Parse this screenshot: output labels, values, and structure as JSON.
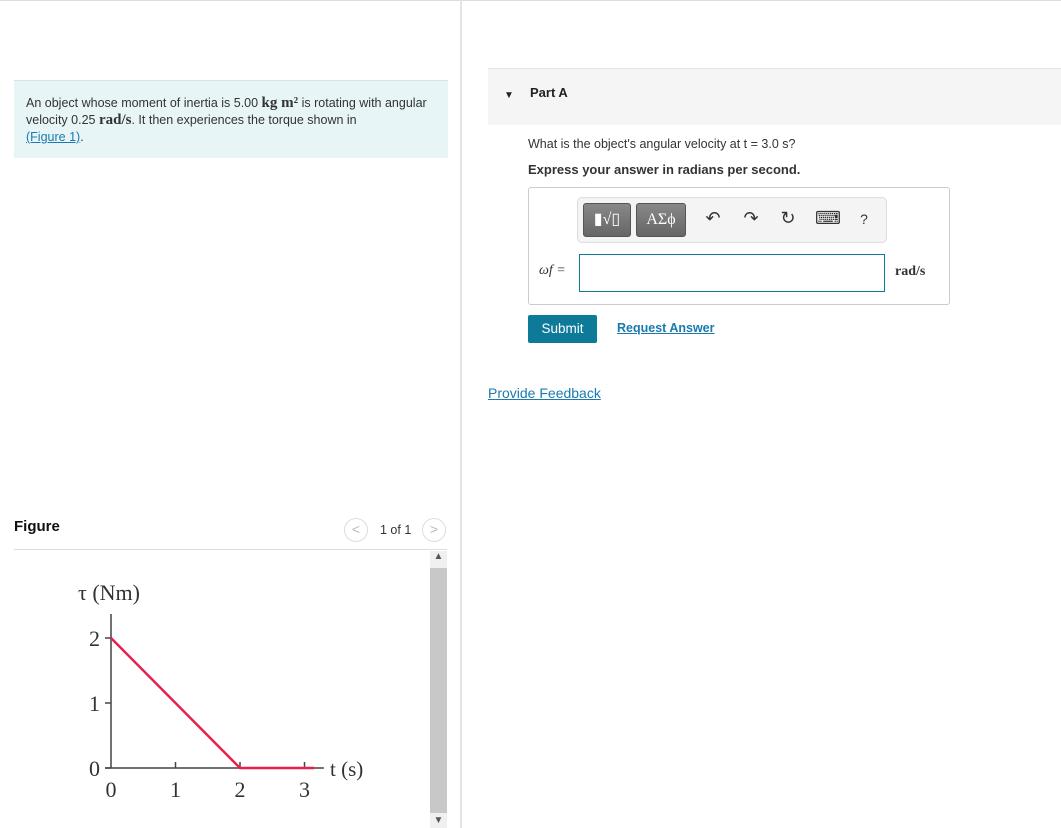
{
  "problem": {
    "t1": "An object whose moment of inertia is 5.00 ",
    "u1": "kg m²",
    "t2": " is rotating with angular velocity 0.25 ",
    "u2": "rad/s",
    "t3": ". It then experiences the torque shown in ",
    "link": "(Figure 1)",
    "t4": "."
  },
  "figure": {
    "title": "Figure",
    "pager": "1 of 1",
    "prev": "<",
    "next": ">"
  },
  "chart_data": {
    "type": "line",
    "ylabel": "τ (Nm)",
    "xlabel": "t (s)",
    "xticks": [
      "0",
      "1",
      "2",
      "3"
    ],
    "yticks": [
      "0",
      "1",
      "2"
    ],
    "xlim": [
      0,
      3.3
    ],
    "ylim": [
      0,
      2.4
    ],
    "line_color": "#e8204e",
    "points": [
      [
        0,
        2
      ],
      [
        2,
        0
      ],
      [
        3.15,
        0
      ]
    ]
  },
  "part": {
    "label": "Part A",
    "question": "What is the object's angular velocity at t = 3.0 s?",
    "instruction": "Express your answer in radians per second."
  },
  "toolbar": {
    "templates": "▮√▯",
    "greek": "ΑΣϕ",
    "undo": "↶",
    "redo": "↷",
    "reset": "↻",
    "keyboard": "⌨",
    "help": "?"
  },
  "answer": {
    "label": "ωf =",
    "value": "",
    "unit": "rad/s"
  },
  "actions": {
    "submit": "Submit",
    "request": "Request Answer",
    "feedback": "Provide Feedback"
  }
}
